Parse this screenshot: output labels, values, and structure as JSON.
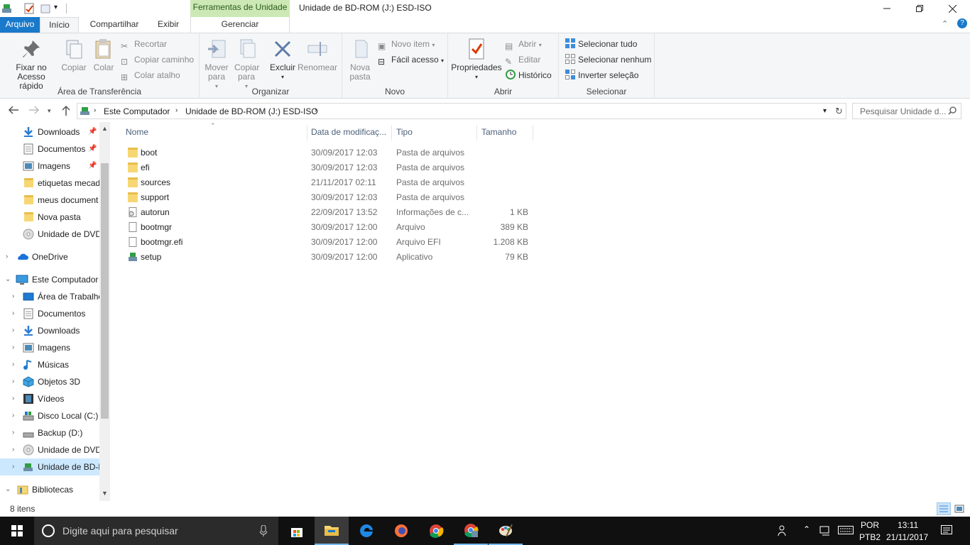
{
  "titlebar": {
    "context_tab": "Ferramentas de Unidade",
    "title": "Unidade de BD-ROM (J:) ESD-ISO"
  },
  "ribbon_tabs": [
    "Arquivo",
    "Início",
    "Compartilhar",
    "Exibir",
    "Gerenciar"
  ],
  "ribbon": {
    "groups": {
      "clipboard": "Área de Transferência",
      "organize": "Organizar",
      "new": "Novo",
      "open": "Abrir",
      "select": "Selecionar"
    },
    "pin": "Fixar no Acesso rápido",
    "copy": "Copiar",
    "paste": "Colar",
    "cut": "Recortar",
    "copy_path": "Copiar caminho",
    "paste_shortcut": "Colar atalho",
    "move_to": "Mover para",
    "copy_to": "Copiar para",
    "delete": "Excluir",
    "rename": "Renomear",
    "new_folder": "Nova pasta",
    "new_item": "Novo item",
    "easy_access": "Fácil acesso",
    "properties": "Propriedades",
    "open": "Abrir",
    "edit": "Editar",
    "history": "Histórico",
    "select_all": "Selecionar tudo",
    "select_none": "Selecionar nenhum",
    "invert_selection": "Inverter seleção"
  },
  "address": {
    "crumbs": [
      "Este Computador",
      "Unidade de BD-ROM (J:) ESD-ISO"
    ],
    "search_placeholder": "Pesquisar Unidade d..."
  },
  "nav": {
    "quick_access": [
      {
        "label": "Downloads",
        "icon": "download-icon",
        "pinned": true
      },
      {
        "label": "Documentos",
        "icon": "documents-icon",
        "pinned": true
      },
      {
        "label": "Imagens",
        "icon": "pictures-icon",
        "pinned": true
      },
      {
        "label": "etiquetas mecad",
        "icon": "folder-icon",
        "pinned": false
      },
      {
        "label": "meus document",
        "icon": "folder-icon",
        "pinned": false
      },
      {
        "label": "Nova pasta",
        "icon": "folder-icon",
        "pinned": false
      },
      {
        "label": "Unidade de DVD",
        "icon": "dvd-icon",
        "pinned": false
      }
    ],
    "onedrive": "OneDrive",
    "this_pc": "Este Computador",
    "pc_items": [
      {
        "label": "Área de Trabalho",
        "icon": "desktop-icon"
      },
      {
        "label": "Documentos",
        "icon": "documents-icon"
      },
      {
        "label": "Downloads",
        "icon": "download-icon"
      },
      {
        "label": "Imagens",
        "icon": "pictures-icon"
      },
      {
        "label": "Músicas",
        "icon": "music-icon"
      },
      {
        "label": "Objetos 3D",
        "icon": "3d-objects-icon"
      },
      {
        "label": "Vídeos",
        "icon": "videos-icon"
      },
      {
        "label": "Disco Local (C:)",
        "icon": "drive-icon"
      },
      {
        "label": "Backup (D:)",
        "icon": "drive-icon"
      },
      {
        "label": "Unidade de DVD",
        "icon": "dvd-icon"
      },
      {
        "label": "Unidade de BD-R",
        "icon": "bd-rom-icon"
      }
    ],
    "libraries": "Bibliotecas"
  },
  "columns": [
    "Nome",
    "Data de modificaç...",
    "Tipo",
    "Tamanho"
  ],
  "files": [
    {
      "name": "boot",
      "date": "30/09/2017 12:03",
      "type": "Pasta de arquivos",
      "size": "",
      "icon": "folder-icon"
    },
    {
      "name": "efi",
      "date": "30/09/2017 12:03",
      "type": "Pasta de arquivos",
      "size": "",
      "icon": "folder-icon"
    },
    {
      "name": "sources",
      "date": "21/11/2017 02:11",
      "type": "Pasta de arquivos",
      "size": "",
      "icon": "folder-icon"
    },
    {
      "name": "support",
      "date": "30/09/2017 12:03",
      "type": "Pasta de arquivos",
      "size": "",
      "icon": "folder-icon"
    },
    {
      "name": "autorun",
      "date": "22/09/2017 13:52",
      "type": "Informações de c...",
      "size": "1 KB",
      "icon": "settings-file-icon"
    },
    {
      "name": "bootmgr",
      "date": "30/09/2017 12:00",
      "type": "Arquivo",
      "size": "389 KB",
      "icon": "file-icon"
    },
    {
      "name": "bootmgr.efi",
      "date": "30/09/2017 12:00",
      "type": "Arquivo EFI",
      "size": "1.208 KB",
      "icon": "file-icon"
    },
    {
      "name": "setup",
      "date": "30/09/2017 12:00",
      "type": "Aplicativo",
      "size": "79 KB",
      "icon": "setup-app-icon"
    }
  ],
  "status": {
    "count": "8 itens"
  },
  "taskbar": {
    "search_placeholder": "Digite aqui para pesquisar",
    "lang": "POR",
    "layout": "PTB2",
    "time": "13:11",
    "date": "21/11/2017"
  },
  "colors": {
    "accent": "#1979ca",
    "context_tab": "#cce8b5",
    "folder": "#f7d774",
    "taskbar": "#101010"
  }
}
